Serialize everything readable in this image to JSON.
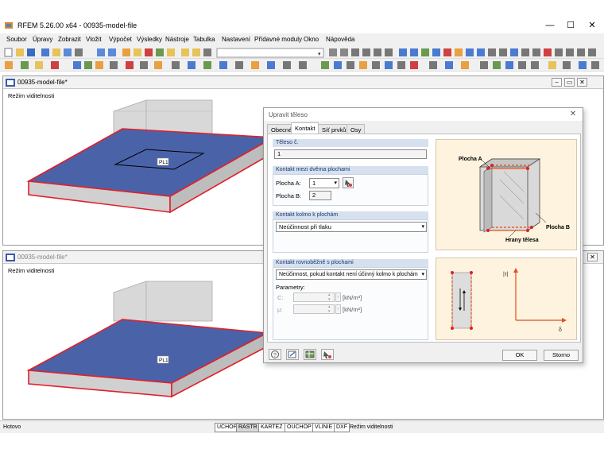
{
  "window": {
    "title": "RFEM 5.26.00 x64 - 00935-model-file",
    "minimize": "—",
    "maximize": "☐",
    "close": "✕"
  },
  "menu": [
    "Soubor",
    "Úpravy",
    "Zobrazit",
    "Vložit",
    "Výpočet",
    "Výsledky",
    "Nástroje",
    "Tabulka",
    "Nastavení",
    "Přídavné moduly",
    "Okno",
    "Nápověda"
  ],
  "mdi_top": {
    "title": "00935-model-file*",
    "view_mode": "Režim viditelnosti",
    "plate_label": "PL1"
  },
  "mdi_bottom": {
    "title": "00935-model-file*",
    "view_mode": "Režim viditelnosti",
    "plate_label": "PL1"
  },
  "dialog": {
    "title": "Upravit těleso",
    "close": "✕",
    "tabs": [
      "Obecné",
      "Kontakt",
      "Síť prvků",
      "Osy"
    ],
    "active_tab": "Kontakt",
    "solid_no": {
      "header": "Těleso č.",
      "value": "1"
    },
    "contact_surfaces": {
      "header": "Kontakt mezi dvěma plochami",
      "surface_a_label": "Plocha A:",
      "surface_a_value": "1",
      "surface_b_label": "Plocha B:",
      "surface_b_value": "2"
    },
    "perpendicular": {
      "header": "Kontakt kolmo k plochám",
      "value": "Neúčinnost při tlaku"
    },
    "parallel": {
      "header": "Kontakt rovnoběžně s plochami",
      "value": "Neúčinnost, pokud kontakt není účinný kolmo k plochám",
      "params_label": "Parametry:",
      "c_label": "C:",
      "c_unit": "[kN/m³]",
      "mu_label": "μ:",
      "mu_unit": "[kN/m²]"
    },
    "figure_top": {
      "label_a": "Plocha A",
      "label_b": "Plocha B",
      "label_edges": "Hrany tělesa"
    },
    "figure_bottom": {
      "y_label": "|τ|",
      "x_label": "δ"
    },
    "ok": "OK",
    "cancel": "Storno"
  },
  "status": {
    "ready": "Hotovo",
    "buttons": [
      "UCHOP",
      "RASTR",
      "KARTEZ",
      "OUCHOP",
      "VLINIE",
      "DXF"
    ],
    "pressed": [
      "RASTR"
    ],
    "mode": "Režim viditelnosti"
  },
  "colors": {
    "plate_fill": "#4a63a8",
    "plate_edge": "#e0202a",
    "accent": "#1a3c6e"
  }
}
